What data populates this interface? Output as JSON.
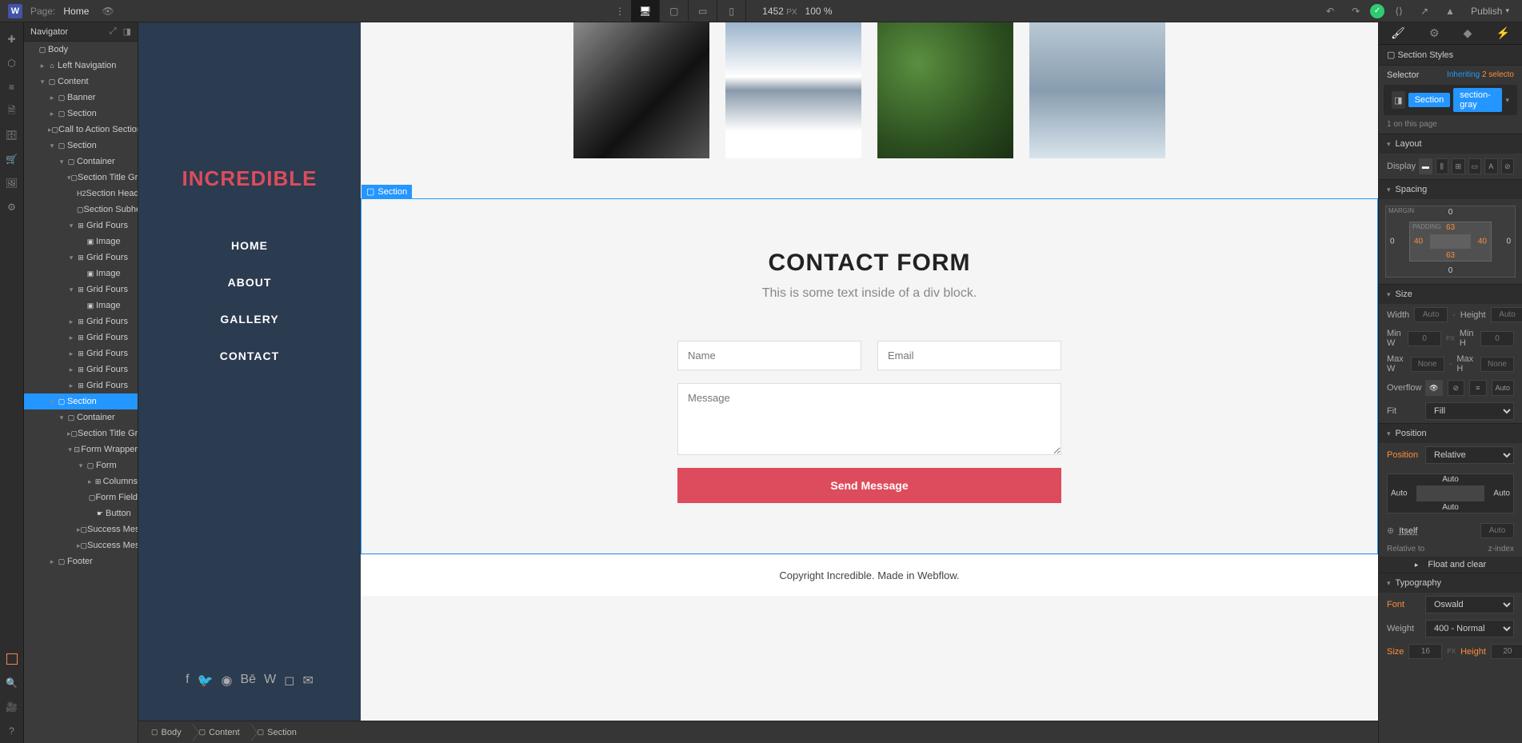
{
  "topbar": {
    "page_label": "Page:",
    "page_name": "Home",
    "canvas_width": "1452",
    "canvas_unit": "PX",
    "zoom": "100 %",
    "publish": "Publish"
  },
  "navigator": {
    "title": "Navigator",
    "tree": [
      {
        "indent": 0,
        "toggle": "",
        "icon": "▢",
        "label": "Body"
      },
      {
        "indent": 1,
        "toggle": "▸",
        "icon": "⌂",
        "label": "Left Navigation"
      },
      {
        "indent": 1,
        "toggle": "▾",
        "icon": "▢",
        "label": "Content"
      },
      {
        "indent": 2,
        "toggle": "▸",
        "icon": "▢",
        "label": "Banner"
      },
      {
        "indent": 2,
        "toggle": "▸",
        "icon": "▢",
        "label": "Section"
      },
      {
        "indent": 2,
        "toggle": "▸",
        "icon": "▢",
        "label": "Call to Action Section"
      },
      {
        "indent": 2,
        "toggle": "▾",
        "icon": "▢",
        "label": "Section"
      },
      {
        "indent": 3,
        "toggle": "▾",
        "icon": "▢",
        "label": "Container"
      },
      {
        "indent": 4,
        "toggle": "▾",
        "icon": "▢",
        "label": "Section Title Group"
      },
      {
        "indent": 5,
        "toggle": "",
        "icon": "H2",
        "label": "Section Heading"
      },
      {
        "indent": 5,
        "toggle": "",
        "icon": "▢",
        "label": "Section Subhead"
      },
      {
        "indent": 4,
        "toggle": "▾",
        "icon": "⊞",
        "label": "Grid Fours"
      },
      {
        "indent": 5,
        "toggle": "",
        "icon": "▣",
        "label": "Image"
      },
      {
        "indent": 4,
        "toggle": "▾",
        "icon": "⊞",
        "label": "Grid Fours"
      },
      {
        "indent": 5,
        "toggle": "",
        "icon": "▣",
        "label": "Image"
      },
      {
        "indent": 4,
        "toggle": "▾",
        "icon": "⊞",
        "label": "Grid Fours"
      },
      {
        "indent": 5,
        "toggle": "",
        "icon": "▣",
        "label": "Image"
      },
      {
        "indent": 4,
        "toggle": "▸",
        "icon": "⊞",
        "label": "Grid Fours"
      },
      {
        "indent": 4,
        "toggle": "▸",
        "icon": "⊞",
        "label": "Grid Fours"
      },
      {
        "indent": 4,
        "toggle": "▸",
        "icon": "⊞",
        "label": "Grid Fours"
      },
      {
        "indent": 4,
        "toggle": "▸",
        "icon": "⊞",
        "label": "Grid Fours"
      },
      {
        "indent": 4,
        "toggle": "▸",
        "icon": "⊞",
        "label": "Grid Fours"
      },
      {
        "indent": 2,
        "toggle": "▾",
        "icon": "▢",
        "label": "Section",
        "selected": true
      },
      {
        "indent": 3,
        "toggle": "▾",
        "icon": "▢",
        "label": "Container"
      },
      {
        "indent": 4,
        "toggle": "▸",
        "icon": "▢",
        "label": "Section Title Group"
      },
      {
        "indent": 4,
        "toggle": "▾",
        "icon": "⊡",
        "label": "Form Wrapper"
      },
      {
        "indent": 5,
        "toggle": "▾",
        "icon": "▢",
        "label": "Form"
      },
      {
        "indent": 6,
        "toggle": "▸",
        "icon": "⊞",
        "label": "Columns"
      },
      {
        "indent": 6,
        "toggle": "",
        "icon": "▢",
        "label": "Form Field"
      },
      {
        "indent": 6,
        "toggle": "",
        "icon": "☛",
        "label": "Button"
      },
      {
        "indent": 5,
        "toggle": "▸",
        "icon": "▢",
        "label": "Success Messag"
      },
      {
        "indent": 5,
        "toggle": "▸",
        "icon": "▢",
        "label": "Success Messag"
      },
      {
        "indent": 2,
        "toggle": "▸",
        "icon": "▢",
        "label": "Footer"
      }
    ]
  },
  "site": {
    "logo": "INCREDIBLE",
    "menu": [
      "HOME",
      "ABOUT",
      "GALLERY",
      "CONTACT"
    ],
    "section_tag": "Section",
    "contact_heading": "CONTACT FORM",
    "contact_sub": "This is some text inside of a div block.",
    "name_placeholder": "Name",
    "email_placeholder": "Email",
    "message_placeholder": "Message",
    "send_btn": "Send Message",
    "footer": "Copyright Incredible. Made in Webflow."
  },
  "breadcrumb": [
    "Body",
    "Content",
    "Section"
  ],
  "right": {
    "section_styles": "Section Styles",
    "selector_label": "Selector",
    "inheriting_label": "Inheriting",
    "inheriting_count": "2 selecto",
    "tags": [
      "Section",
      "section-gray"
    ],
    "page_count": "1 on this page",
    "layout_head": "Layout",
    "display_label": "Display",
    "spacing_head": "Spacing",
    "margin_label": "MARGIN",
    "padding_label": "PADDING",
    "margin": {
      "top": "0",
      "right": "0",
      "bottom": "0",
      "left": "0"
    },
    "padding": {
      "top": "63",
      "right": "40",
      "bottom": "63",
      "left": "40"
    },
    "size_head": "Size",
    "width_label": "Width",
    "width_val": "Auto",
    "height_label": "Height",
    "height_val": "Auto",
    "minw_label": "Min W",
    "minw_val": "0",
    "minw_unit": "PX",
    "minh_label": "Min H",
    "minh_val": "0",
    "maxw_label": "Max W",
    "maxw_val": "None",
    "maxh_label": "Max H",
    "maxh_val": "None",
    "overflow_label": "Overflow",
    "overflow_auto": "Auto",
    "fit_label": "Fit",
    "fit_val": "Fill",
    "position_head": "Position",
    "position_label": "Position",
    "position_val": "Relative",
    "pos_top": "Auto",
    "pos_right": "Auto",
    "pos_bottom": "Auto",
    "pos_left": "Auto",
    "relative_to": "Relative to",
    "itself": "Itself",
    "zindex_label": "z-index",
    "zindex_val": "Auto",
    "float_clear": "Float and clear",
    "typo_head": "Typography",
    "font_label": "Font",
    "font_val": "Oswald",
    "weight_label": "Weight",
    "weight_val": "400 - Normal",
    "size_label": "Size",
    "size_val": "16",
    "size_unit": "PX",
    "lheight_label": "Height",
    "lheight_val": "20"
  }
}
